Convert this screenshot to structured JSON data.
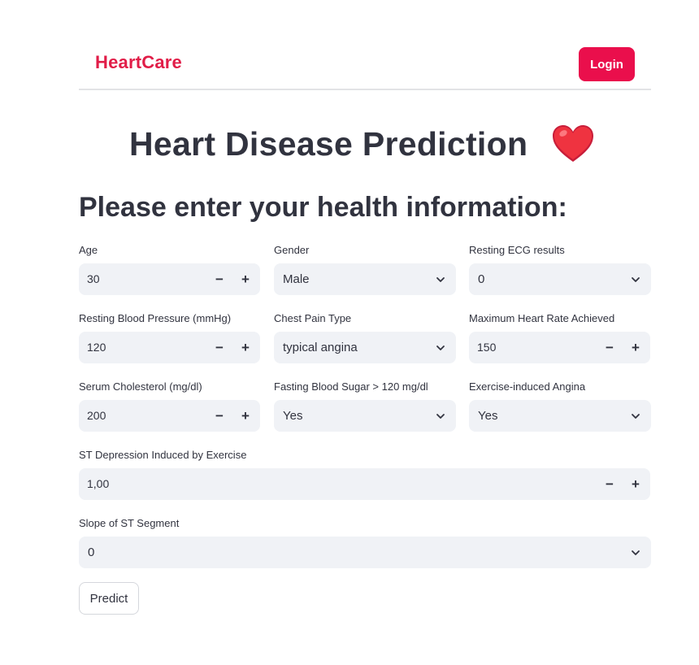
{
  "navbar": {
    "brand": "HeartCare",
    "login_label": "Login"
  },
  "header": {
    "title": "Heart Disease Prediction",
    "icon": "heart-icon"
  },
  "form": {
    "heading": "Please enter your health information:",
    "age": {
      "label": "Age",
      "value": "30"
    },
    "gender": {
      "label": "Gender",
      "value": "Male"
    },
    "resting_ecg": {
      "label": "Resting ECG results",
      "value": "0"
    },
    "resting_bp": {
      "label": "Resting Blood Pressure (mmHg)",
      "value": "120"
    },
    "chest_pain": {
      "label": "Chest Pain Type",
      "value": "typical angina"
    },
    "max_hr": {
      "label": "Maximum Heart Rate Achieved",
      "value": "150"
    },
    "cholesterol": {
      "label": "Serum Cholesterol (mg/dl)",
      "value": "200"
    },
    "fasting_bs": {
      "label": "Fasting Blood Sugar > 120 mg/dl",
      "value": "Yes"
    },
    "exercise_angina": {
      "label": "Exercise-induced Angina",
      "value": "Yes"
    },
    "st_depression": {
      "label": "ST Depression Induced by Exercise",
      "value": "1,00"
    },
    "st_slope": {
      "label": "Slope of ST Segment",
      "value": "0"
    },
    "predict_label": "Predict"
  },
  "colors": {
    "accent": "#ea0f4c",
    "input_bg": "#f0f2f6",
    "text": "#31333f"
  }
}
